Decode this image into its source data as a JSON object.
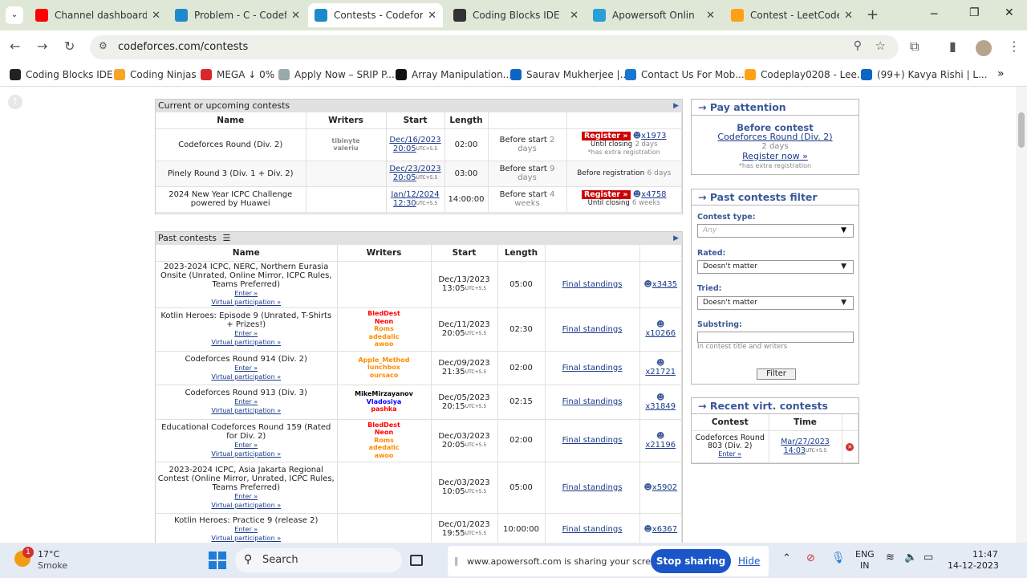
{
  "tabs": [
    {
      "title": "Channel dashboard -",
      "color": "#ff0000"
    },
    {
      "title": "Problem - C - Codefo",
      "color": "#1f8acb"
    },
    {
      "title": "Contests - Codeforce",
      "color": "#1f8acb"
    },
    {
      "title": "Coding Blocks IDE",
      "color": "#333333"
    },
    {
      "title": "Apowersoft Onlin",
      "color": "#2a9fd6"
    },
    {
      "title": "Contest - LeetCode",
      "color": "#ffa116"
    }
  ],
  "url": "codeforces.com/contests",
  "bookmarks": [
    {
      "label": "Coding Blocks IDE",
      "color": "#222"
    },
    {
      "label": "Coding Ninjas",
      "color": "#f5a623"
    },
    {
      "label": "MEGA ↓ 0%",
      "color": "#d9272e"
    },
    {
      "label": "Apply Now – SRIP P...",
      "color": "#9aa"
    },
    {
      "label": "Array Manipulation...",
      "color": "#111"
    },
    {
      "label": "Saurav Mukherjee |...",
      "color": "#0a66c2"
    },
    {
      "label": "Contact Us For Mob...",
      "color": "#1976d2"
    },
    {
      "label": "Codeplay0208 - Lee...",
      "color": "#ffa116"
    },
    {
      "label": "(99+) Kavya Rishi | L...",
      "color": "#0a66c2"
    }
  ],
  "current": {
    "title": "Current or upcoming contests",
    "headers": [
      "Name",
      "Writers",
      "Start",
      "Length",
      "",
      ""
    ],
    "rows": [
      {
        "name": "Codeforces Round (Div. 2)",
        "writers": [
          "tibinyte",
          "valeriu"
        ],
        "date": "Dec/16/2023",
        "time": "20:05",
        "len": "02:00",
        "before": "Before start",
        "bnum": "2",
        "bunit": "days",
        "reg": "Register »",
        "users": "x1973",
        "closing": "Until closing",
        "cnum": "2 days",
        "extra": "*has extra registration"
      },
      {
        "name": "Pinely Round 3 (Div. 1 + Div. 2)",
        "writers": [],
        "date": "Dec/23/2023",
        "time": "20:05",
        "len": "03:00",
        "before": "Before start",
        "bnum": "9",
        "bunit": "days",
        "beforereg": "Before registration",
        "brnum": "6 days"
      },
      {
        "name": "2024 New Year ICPC Challenge powered by Huawei",
        "writers": [],
        "date": "Jan/12/2024",
        "time": "12:30",
        "len": "14:00:00",
        "before": "Before start",
        "bnum": "4",
        "bunit": "weeks",
        "reg": "Register »",
        "users": "x4758",
        "closing": "Until closing",
        "cnum": "6 weeks"
      }
    ]
  },
  "past": {
    "title": "Past contests",
    "headers": [
      "Name",
      "Writers",
      "Start",
      "Length",
      "",
      ""
    ],
    "enter": "Enter »",
    "virtual": "Virtual participation »",
    "standings": "Final standings",
    "rows": [
      {
        "name": "2023-2024 ICPC, NERC, Northern Eurasia Onsite (Unrated, Online Mirror, ICPC Rules, Teams Preferred)",
        "writers": [],
        "date": "Dec/13/2023",
        "time": "13:05",
        "len": "05:00",
        "users": "x3435"
      },
      {
        "name": "Kotlin Heroes: Episode 9 (Unrated, T-Shirts + Prizes!)",
        "writers": [
          {
            "n": "BledDest",
            "c": "#ff0000"
          },
          {
            "n": "Neon",
            "c": "#ff0000"
          },
          {
            "n": "Roms",
            "c": "#ff8c00"
          },
          {
            "n": "adedalic",
            "c": "#ff8c00"
          },
          {
            "n": "awoo",
            "c": "#ff8c00"
          }
        ],
        "date": "Dec/11/2023",
        "time": "20:05",
        "len": "02:30",
        "users": "x10266"
      },
      {
        "name": "Codeforces Round 914 (Div. 2)",
        "writers": [
          {
            "n": "Apple_Method",
            "c": "#ff8c00"
          },
          {
            "n": "lunchbox",
            "c": "#ff8c00"
          },
          {
            "n": "oursaco",
            "c": "#ff8c00"
          }
        ],
        "date": "Dec/09/2023",
        "time": "21:35",
        "len": "02:00",
        "users": "x21721"
      },
      {
        "name": "Codeforces Round 913 (Div. 3)",
        "writers": [
          {
            "n": "MikeMirzayanov",
            "c": "#000000"
          },
          {
            "n": "Vladosiya",
            "c": "#0000ff"
          },
          {
            "n": "pashka",
            "c": "#ff0000"
          }
        ],
        "date": "Dec/05/2023",
        "time": "20:15",
        "len": "02:15",
        "users": "x31849"
      },
      {
        "name": "Educational Codeforces Round 159 (Rated for Div. 2)",
        "writers": [
          {
            "n": "BledDest",
            "c": "#ff0000"
          },
          {
            "n": "Neon",
            "c": "#ff0000"
          },
          {
            "n": "Roms",
            "c": "#ff8c00"
          },
          {
            "n": "adedalic",
            "c": "#ff8c00"
          },
          {
            "n": "awoo",
            "c": "#ff8c00"
          }
        ],
        "date": "Dec/03/2023",
        "time": "20:05",
        "len": "02:00",
        "users": "x21196"
      },
      {
        "name": "2023-2024 ICPC, Asia Jakarta Regional Contest (Online Mirror, Unrated, ICPC Rules, Teams Preferred)",
        "writers": [],
        "date": "Dec/03/2023",
        "time": "10:05",
        "len": "05:00",
        "users": "x5902"
      },
      {
        "name": "Kotlin Heroes: Practice 9 (release 2)",
        "writers": [],
        "date": "Dec/01/2023",
        "time": "19:55",
        "len": "10:00:00",
        "users": "x6367"
      }
    ]
  },
  "utc": "UTC+5.5",
  "attention": {
    "title": "→ Pay attention",
    "before": "Before contest",
    "contest": "Codeforces Round (Div. 2)",
    "left": "2 days",
    "register": "Register now »",
    "extra": "*has extra registration"
  },
  "filter": {
    "title": "→ Past contests filter",
    "type_label": "Contest type:",
    "type_value": "Any",
    "rated_label": "Rated:",
    "rated_value": "Doesn't matter",
    "tried_label": "Tried:",
    "tried_value": "Doesn't matter",
    "sub_label": "Substring:",
    "sub_hint": "In contest title and writers",
    "button": "Filter"
  },
  "recent": {
    "title": "→ Recent virt. contests",
    "col1": "Contest",
    "col2": "Time",
    "contest": "Codeforces Round 803 (Div. 2)",
    "enter": "Enter »",
    "date": "Mar/27/2023",
    "time": "14:03"
  },
  "taskbar": {
    "temp": "17°C",
    "weather": "Smoke",
    "badge": "1",
    "search": "Search",
    "share_text": "www.apowersoft.com is sharing your screen.",
    "stop": "Stop sharing",
    "hide": "Hide",
    "lang1": "ENG",
    "lang2": "IN",
    "time": "11:47",
    "date": "14-12-2023"
  }
}
